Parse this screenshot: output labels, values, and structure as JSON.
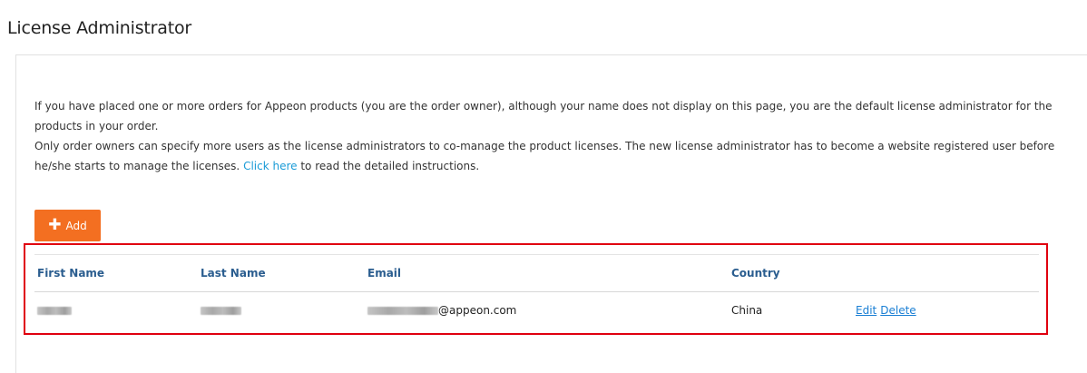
{
  "page": {
    "title": "License Administrator"
  },
  "intro": {
    "para1": "If you have placed one or more orders for Appeon products (you are the order owner), although your name does not display on this page, you are the default license administrator for the products in your order.",
    "para2_before": "Only order owners can specify more users as the license administrators to co-manage the product licenses. The new license administrator has to become a website registered user before he/she starts to manage the licenses. ",
    "para2_link": "Click here",
    "para2_after": " to read the detailed instructions."
  },
  "toolbar": {
    "add_icon": "plus-icon",
    "add_label": "Add"
  },
  "table": {
    "columns": [
      "First Name",
      "Last Name",
      "Email",
      "Country",
      ""
    ],
    "rows": [
      {
        "email_domain": "@appeon.com",
        "country": "China",
        "edit_label": "Edit",
        "delete_label": "Delete"
      }
    ]
  },
  "colors": {
    "accent": "#f36f21",
    "link": "#1a9bd7",
    "header_text": "#2a5d8f",
    "highlight": "#e0000f"
  }
}
